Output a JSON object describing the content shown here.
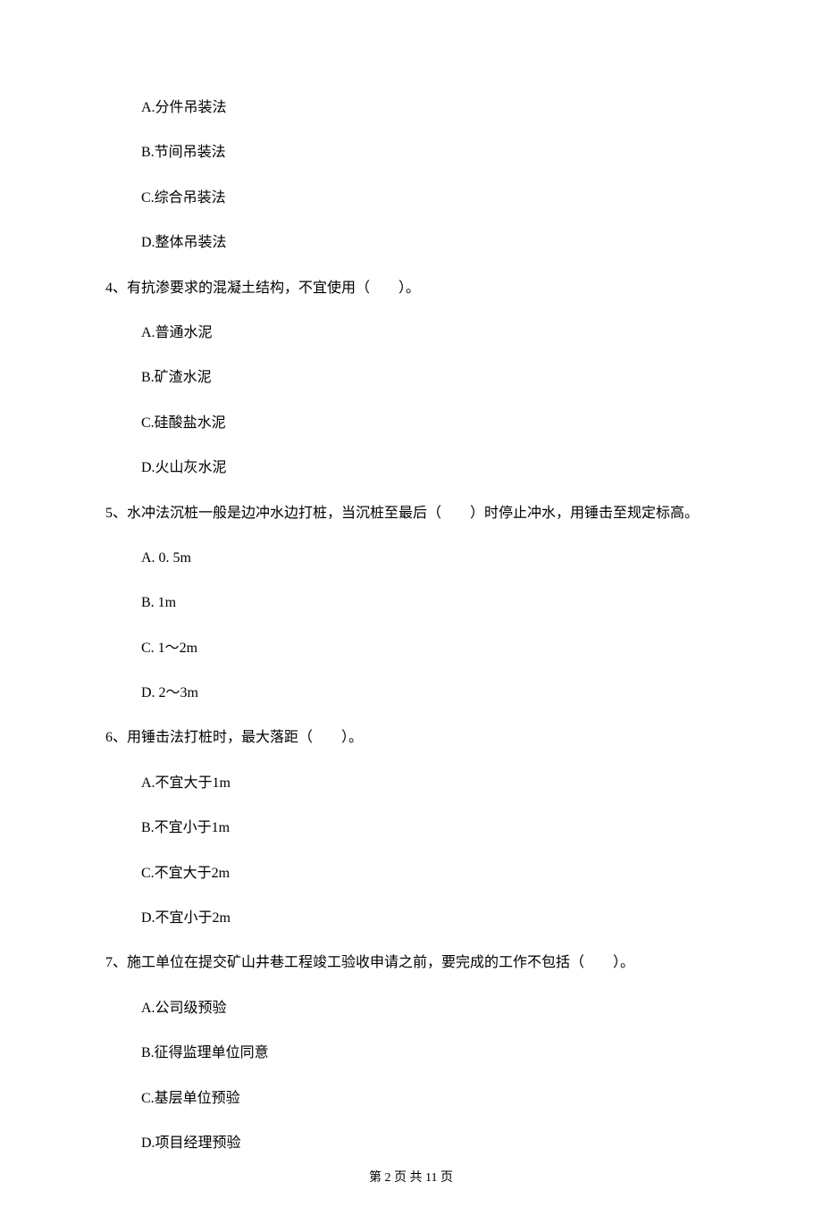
{
  "q3_options": {
    "a": "A.分件吊装法",
    "b": "B.节间吊装法",
    "c": "C.综合吊装法",
    "d": "D.整体吊装法"
  },
  "q4": {
    "text": "4、有抗渗要求的混凝土结构，不宜使用（　　）。",
    "a": "A.普通水泥",
    "b": "B.矿渣水泥",
    "c": "C.硅酸盐水泥",
    "d": "D.火山灰水泥"
  },
  "q5": {
    "text": "5、水冲法沉桩一般是边冲水边打桩，当沉桩至最后（　　）时停止冲水，用锤击至规定标高。",
    "a": "A. 0. 5m",
    "b": "B. 1m",
    "c": "C. 1～2m",
    "d": "D. 2～3m"
  },
  "q6": {
    "text": "6、用锤击法打桩时，最大落距（　　）。",
    "a": "A.不宜大于1m",
    "b": "B.不宜小于1m",
    "c": "C.不宜大于2m",
    "d": "D.不宜小于2m"
  },
  "q7": {
    "text": "7、施工单位在提交矿山井巷工程竣工验收申请之前，要完成的工作不包括（　　）。",
    "a": "A.公司级预验",
    "b": "B.征得监理单位同意",
    "c": "C.基层单位预验",
    "d": "D.项目经理预验"
  },
  "footer": "第 2 页 共 11 页"
}
